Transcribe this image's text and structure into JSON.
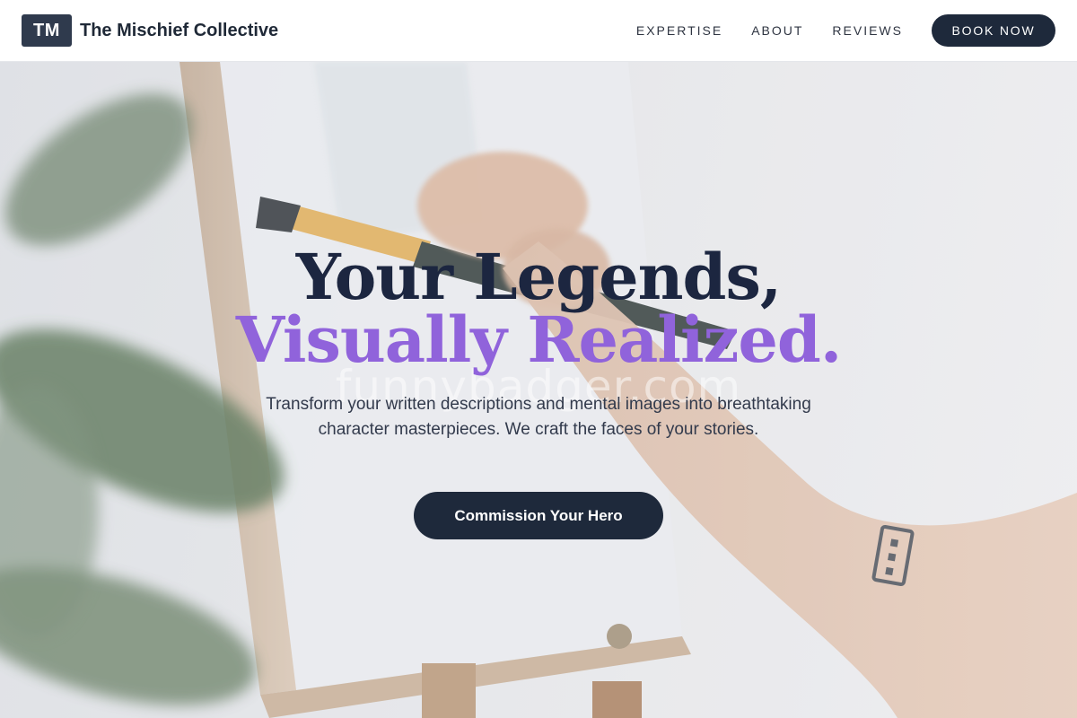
{
  "header": {
    "logo": "TM",
    "brand_name": "The Mischief Collective",
    "nav": [
      {
        "label": "EXPERTISE"
      },
      {
        "label": "ABOUT"
      },
      {
        "label": "REVIEWS"
      }
    ],
    "book_label": "BOOK NOW"
  },
  "hero": {
    "headline_line1": "Your Legends,",
    "headline_line2": "Visually Realized.",
    "subtitle": "Transform your written descriptions and mental images into breathtaking character masterpieces. We craft the faces of your stories.",
    "cta_label": "Commission Your Hero",
    "watermark": "funnybadger.com",
    "background_image": "artist-painting-canvas-photo"
  },
  "colors": {
    "primary_dark": "#1e293b",
    "accent_purple": "#9063db",
    "logo_bg": "#2f3a4d"
  }
}
